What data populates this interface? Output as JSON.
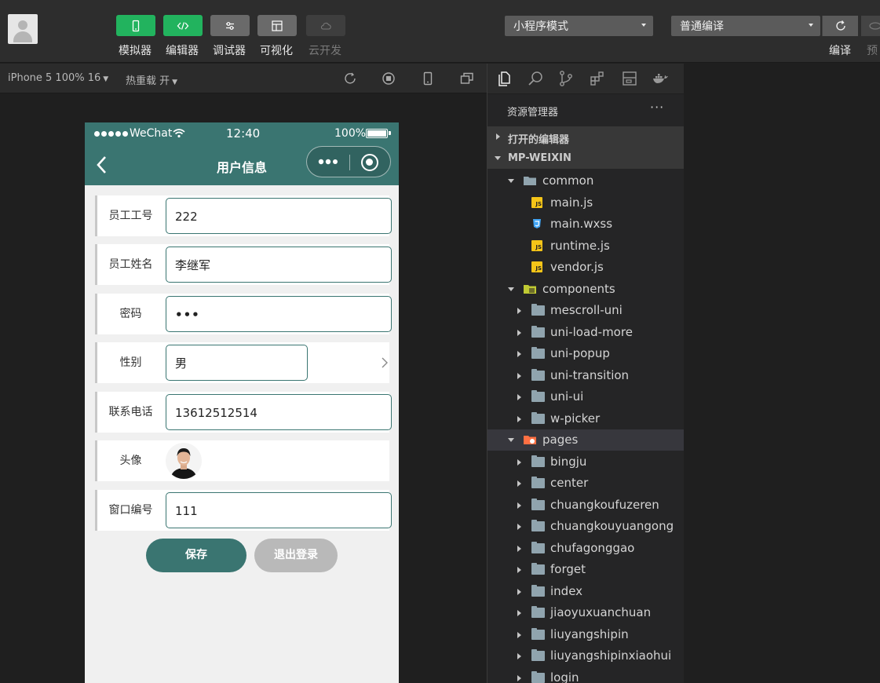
{
  "toolbar": {
    "buttons": [
      {
        "label": "模拟器"
      },
      {
        "label": "编辑器"
      },
      {
        "label": "调试器"
      },
      {
        "label": "可视化"
      },
      {
        "label": "云开发"
      }
    ],
    "mode_select": "小程序模式",
    "compile_select": "普通编译",
    "compile_label": "编译",
    "preview_label": "预"
  },
  "subbar": {
    "device": "iPhone 5 100% 16",
    "hot_reload": "热重载 开"
  },
  "phone": {
    "carrier": "WeChat",
    "time": "12:40",
    "battery": "100%",
    "title": "用户信息",
    "fields": [
      {
        "label": "员工工号",
        "value": "222"
      },
      {
        "label": "员工姓名",
        "value": "李继军"
      },
      {
        "label": "密码",
        "value": "•••"
      },
      {
        "label": "性别",
        "value": "男"
      },
      {
        "label": "联系电话",
        "value": "13612512514"
      },
      {
        "label": "头像",
        "value": ""
      },
      {
        "label": "窗口编号",
        "value": "111"
      }
    ],
    "save_label": "保存",
    "logout_label": "退出登录"
  },
  "explorer": {
    "title": "资源管理器",
    "more": "···",
    "open_editors": "打开的编辑器",
    "project": "MP-WEIXIN",
    "tree": [
      {
        "label": "common",
        "type": "folder-open"
      },
      {
        "label": "main.js",
        "type": "js"
      },
      {
        "label": "main.wxss",
        "type": "css"
      },
      {
        "label": "runtime.js",
        "type": "js"
      },
      {
        "label": "vendor.js",
        "type": "js"
      },
      {
        "label": "components",
        "type": "folder-open"
      },
      {
        "label": "mescroll-uni",
        "type": "folder"
      },
      {
        "label": "uni-load-more",
        "type": "folder"
      },
      {
        "label": "uni-popup",
        "type": "folder"
      },
      {
        "label": "uni-transition",
        "type": "folder"
      },
      {
        "label": "uni-ui",
        "type": "folder"
      },
      {
        "label": "w-picker",
        "type": "folder"
      },
      {
        "label": "pages",
        "type": "folder-open"
      },
      {
        "label": "bingju",
        "type": "folder"
      },
      {
        "label": "center",
        "type": "folder"
      },
      {
        "label": "chuangkoufuzeren",
        "type": "folder"
      },
      {
        "label": "chuangkouyuangong",
        "type": "folder"
      },
      {
        "label": "chufagonggao",
        "type": "folder"
      },
      {
        "label": "forget",
        "type": "folder"
      },
      {
        "label": "index",
        "type": "folder"
      },
      {
        "label": "jiaoyuxuanchuan",
        "type": "folder"
      },
      {
        "label": "liuyangshipin",
        "type": "folder"
      },
      {
        "label": "liuyangshipinxiaohui",
        "type": "folder"
      },
      {
        "label": "login",
        "type": "folder"
      }
    ]
  },
  "colors": {
    "accent_green": "#22b35e",
    "phone_theme": "#3a7571",
    "logout_gray": "#b9b9b9"
  }
}
